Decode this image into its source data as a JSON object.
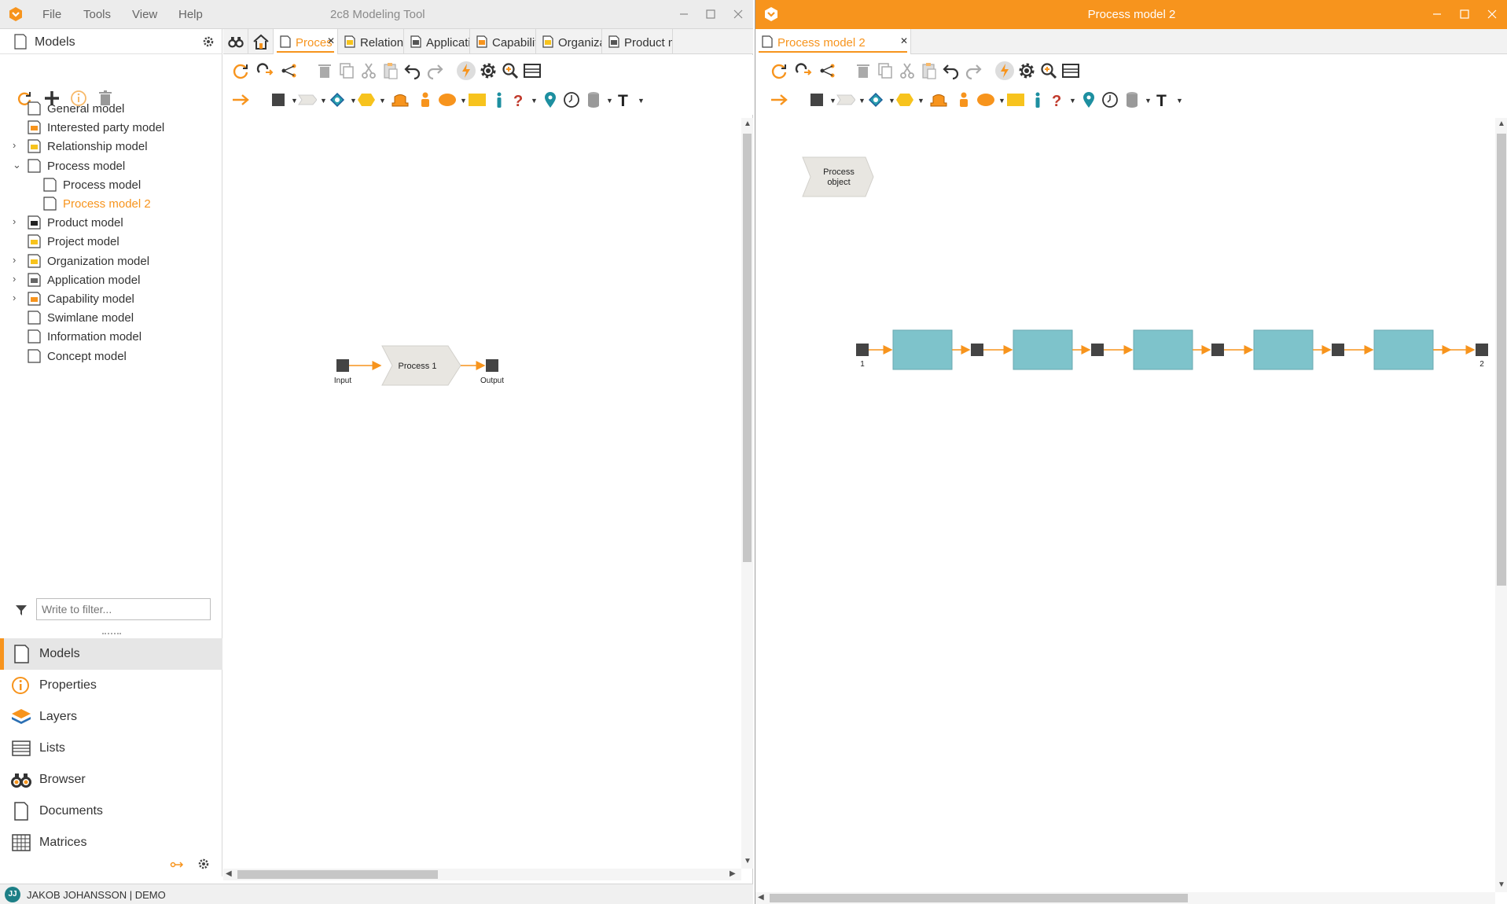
{
  "app": {
    "title": "2c8 Modeling Tool",
    "menu": [
      "File",
      "Tools",
      "View",
      "Help"
    ],
    "accent": "#f7941d"
  },
  "sidebar": {
    "header": "Models",
    "filter_placeholder": "Write to filter...",
    "tree": [
      {
        "label": "General model",
        "expandable": false,
        "level": 0
      },
      {
        "label": "Interested party model",
        "expandable": false,
        "level": 0
      },
      {
        "label": "Relationship model",
        "expandable": true,
        "expanded": false,
        "level": 0
      },
      {
        "label": "Process model",
        "expandable": true,
        "expanded": true,
        "level": 0
      },
      {
        "label": "Process model",
        "expandable": false,
        "level": 1
      },
      {
        "label": "Process model 2",
        "expandable": false,
        "level": 1,
        "selected": true
      },
      {
        "label": "Product model",
        "expandable": true,
        "expanded": false,
        "level": 0
      },
      {
        "label": "Project model",
        "expandable": false,
        "level": 0
      },
      {
        "label": "Organization model",
        "expandable": true,
        "expanded": false,
        "level": 0
      },
      {
        "label": "Application model",
        "expandable": true,
        "expanded": false,
        "level": 0
      },
      {
        "label": "Capability model",
        "expandable": true,
        "expanded": false,
        "level": 0
      },
      {
        "label": "Swimlane model",
        "expandable": false,
        "level": 0
      },
      {
        "label": "Information model",
        "expandable": false,
        "level": 0
      },
      {
        "label": "Concept model",
        "expandable": false,
        "level": 0
      }
    ],
    "nav": [
      "Models",
      "Properties",
      "Layers",
      "Lists",
      "Browser",
      "Documents",
      "Matrices"
    ]
  },
  "status": {
    "initials": "JJ",
    "user": "JAKOB JOHANSSON | DEMO"
  },
  "left_tabs": [
    {
      "label": "Proces",
      "active": true
    },
    {
      "label": "Relations",
      "active": false
    },
    {
      "label": "Applicatio",
      "active": false
    },
    {
      "label": "Capability",
      "active": false
    },
    {
      "label": "Organizat",
      "active": false
    },
    {
      "label": "Product m",
      "active": false
    }
  ],
  "left_canvas": {
    "input_label": "Input",
    "process_label": "Process 1",
    "output_label": "Output"
  },
  "right_window": {
    "title": "Process model 2",
    "tab_label": "Process model 2",
    "palette_object_line1": "Process",
    "palette_object_line2": "object",
    "start_label": "1",
    "end_label": "2",
    "process_box_count": 5,
    "box_color": "#7ec3cb"
  }
}
